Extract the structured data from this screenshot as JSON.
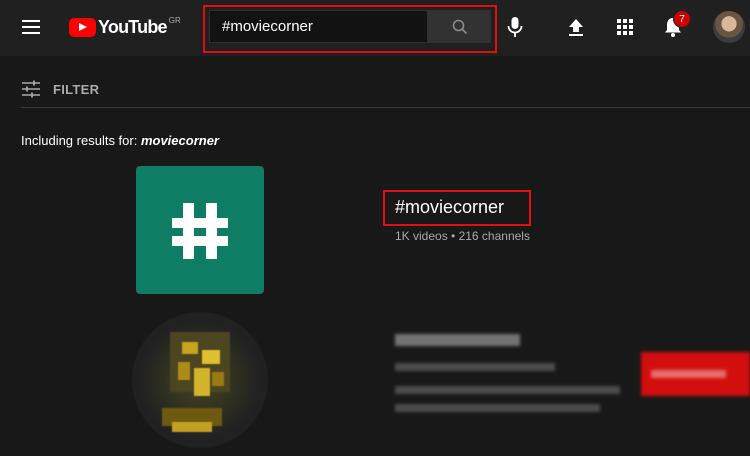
{
  "header": {
    "logo_text": "YouTube",
    "region": "GR",
    "search_value": "#moviecorner",
    "notification_count": "7"
  },
  "filter": {
    "label": "FILTER"
  },
  "results_note": {
    "prefix": "Including results for: ",
    "query": "moviecorner"
  },
  "hashtag_result": {
    "title": "#moviecorner",
    "meta": "1K videos • 216 channels"
  },
  "colors": {
    "header_bg": "#202020",
    "page_bg": "#181818",
    "hashtag_tile": "#0f7c64",
    "highlight": "#e01010",
    "brand_red": "#ff0000"
  },
  "icons": [
    "menu-icon",
    "youtube-logo",
    "search-icon",
    "mic-icon",
    "upload-icon",
    "apps-icon",
    "bell-icon",
    "filter-icon",
    "hashtag-icon"
  ]
}
